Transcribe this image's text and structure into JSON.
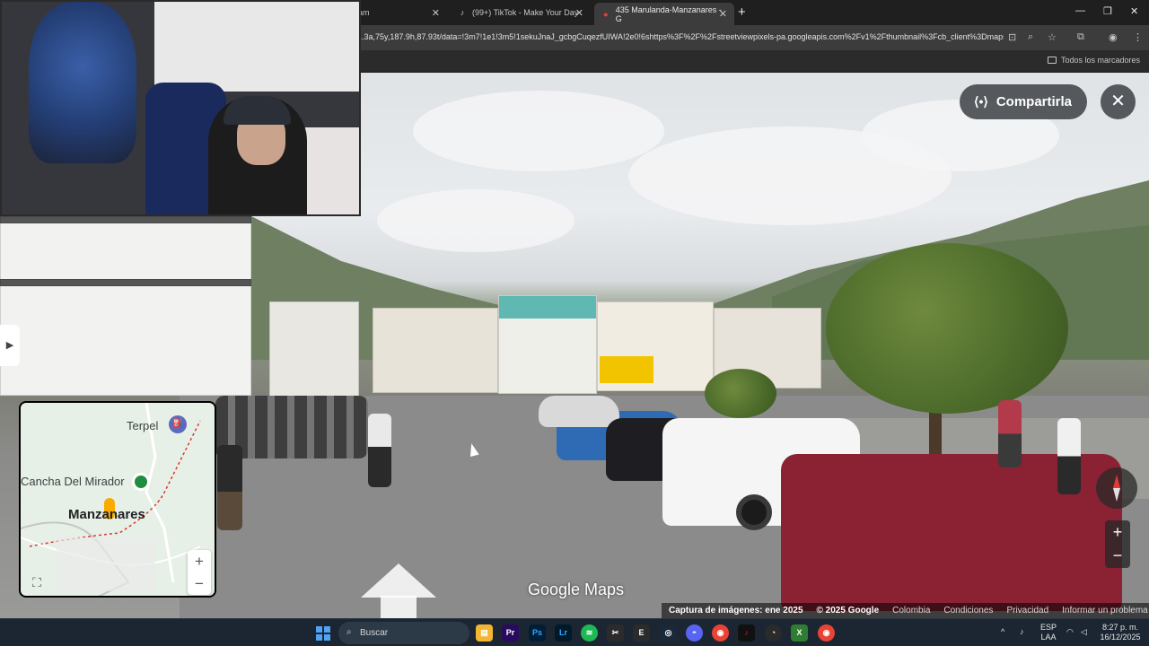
{
  "browser": {
    "tabs": [
      {
        "label": "ram",
        "icon": "instagram-icon"
      },
      {
        "label": "(99+) TikTok - Make Your Day",
        "icon": "tiktok-icon"
      },
      {
        "label": "435 Marulanda-Manzanares - G",
        "icon": "google-maps-icon",
        "active": true
      }
    ],
    "new_tab_label": "+",
    "url": "1.3a,75y,187.9h,87.93t/data=!3m7!1e1!3m5!1sekuJnaJ_gcbgCuqezfUIWA!2e0!6shttps%3F%2F%2Fstreetviewpixels-pa.googleapis.com%2Fv1%2Fthumbnail%3Fcb_client%3Dmaps...",
    "bookmarks_all": "Todos los marcadores"
  },
  "streetview": {
    "share_label": "Compartirla",
    "close_label": "✕",
    "logo": "Google Maps",
    "zoom_in": "+",
    "zoom_out": "−"
  },
  "minimap": {
    "labels": [
      "Terpel",
      "Cancha Del Mirador",
      "Manzanares"
    ],
    "zoom_in": "+",
    "zoom_out": "−"
  },
  "attribution": {
    "capture": "Captura de imágenes: ene 2025",
    "copyright": "© 2025 Google",
    "country": "Colombia",
    "terms": "Condiciones",
    "privacy": "Privacidad",
    "report": "Informar un problema"
  },
  "taskbar": {
    "search_placeholder": "Buscar",
    "language": "ESP",
    "layout": "LAA",
    "time": "8:27 p. m.",
    "date": "16/12/2025",
    "apps": [
      {
        "label": "Pr",
        "color": "#2a0a5e"
      },
      {
        "label": "Ps",
        "color": "#001e36"
      },
      {
        "label": "Lr",
        "color": "#001a2c"
      }
    ]
  },
  "colors": {
    "accent": "#1a73e8",
    "share_bg": "#3c4043",
    "taskbar_bg": "#1c2632"
  }
}
